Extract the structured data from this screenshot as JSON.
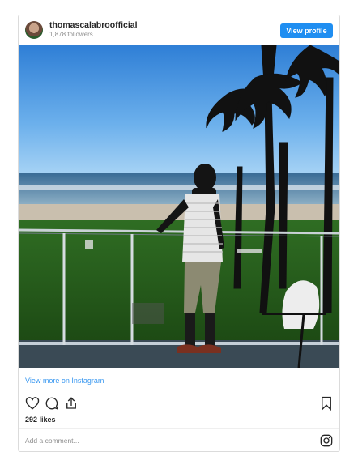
{
  "post": {
    "username": "thomascalabroofficial",
    "followers": "1,878 followers",
    "view_profile_label": "View profile",
    "view_more_label": "View more on Instagram",
    "likes": "292 likes",
    "comment_placeholder": "Add a comment..."
  },
  "icons": {
    "like": "heart-icon",
    "comment": "comment-icon",
    "share": "share-icon",
    "save": "bookmark-icon",
    "instagram": "instagram-icon"
  },
  "colors": {
    "accent": "#1f8ef1",
    "link": "#3897f0"
  }
}
